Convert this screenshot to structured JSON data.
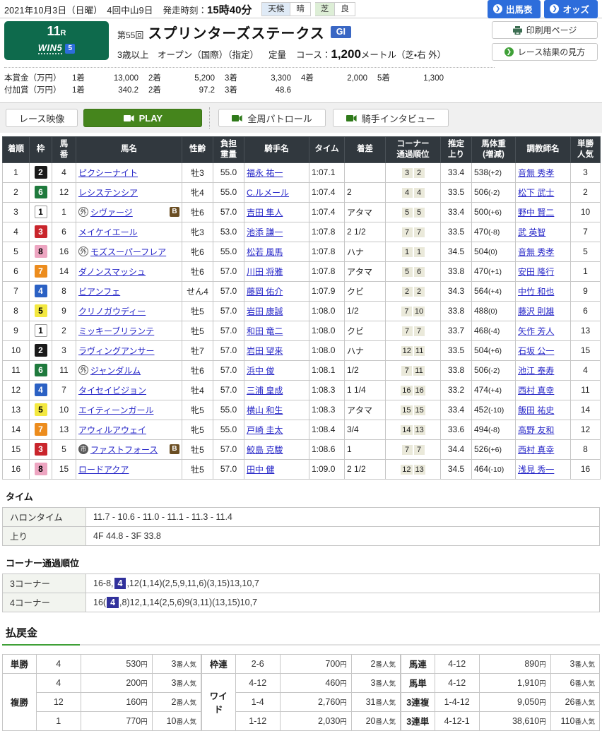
{
  "header": {
    "date": "2021年10月3日（日曜）",
    "meet": "4回中山9日",
    "start_label": "発走時刻：",
    "start_time": "15時40分",
    "weather_label": "天候",
    "weather": "晴",
    "turf_label": "芝",
    "turf_cond": "良",
    "btn_racecard": "出馬表",
    "btn_odds": "オッズ",
    "btn_print": "印刷用ページ",
    "btn_guide": "レース結果の見方"
  },
  "race": {
    "number": "11",
    "r_suffix": "R",
    "win5": "WIN5",
    "win5_badge": "5",
    "edition": "第55回",
    "title": "スプリンターズステークス",
    "grade": "GI",
    "conditions": "3歳以上　オープン（国際）（指定）",
    "weight_rule": "定量",
    "course_label": "コース：",
    "distance": "1,200",
    "course_suffix": "メートル（芝・右 外）"
  },
  "prize": {
    "main_label": "本賞金（万円）",
    "added_label": "付加賞（万円）",
    "places": [
      "1着",
      "2着",
      "3着",
      "4着",
      "5着"
    ],
    "main": [
      "13,000",
      "5,200",
      "3,300",
      "2,000",
      "1,300"
    ],
    "added": [
      "340.2",
      "97.2",
      "48.6"
    ]
  },
  "video": {
    "race_video": "レース映像",
    "play": "PLAY",
    "patrol": "全周パトロール",
    "interview": "騎手インタビュー"
  },
  "results": {
    "columns": [
      "着順",
      "枠",
      "馬\n番",
      "馬名",
      "性齢",
      "負担\n重量",
      "騎手名",
      "タイム",
      "着差",
      "コーナー\n通過順位",
      "推定\n上り",
      "馬体重\n(増減)",
      "調教師名",
      "単勝\n人気"
    ],
    "rows": [
      {
        "pos": "1",
        "frame": "2",
        "num": "4",
        "mark": "",
        "blinker": false,
        "name": "ピクシーナイト",
        "sexage": "牡3",
        "weight": "55.0",
        "jockey": "福永 祐一",
        "time": "1:07.1",
        "margin": "",
        "corners": [
          "3",
          "2"
        ],
        "agari": "33.4",
        "body": "538",
        "diff": "(+2)",
        "trainer": "音無 秀孝",
        "pop": "3"
      },
      {
        "pos": "2",
        "frame": "6",
        "num": "12",
        "mark": "",
        "blinker": false,
        "name": "レシステンシア",
        "sexage": "牝4",
        "weight": "55.0",
        "jockey": "C.ルメール",
        "time": "1:07.4",
        "margin": "2",
        "corners": [
          "4",
          "4"
        ],
        "agari": "33.5",
        "body": "506",
        "diff": "(-2)",
        "trainer": "松下 武士",
        "pop": "2"
      },
      {
        "pos": "3",
        "frame": "1",
        "num": "1",
        "mark": "外",
        "blinker": true,
        "name": "シヴァージ",
        "sexage": "牡6",
        "weight": "57.0",
        "jockey": "吉田 隼人",
        "time": "1:07.4",
        "margin": "アタマ",
        "corners": [
          "5",
          "5"
        ],
        "agari": "33.4",
        "body": "500",
        "diff": "(+6)",
        "trainer": "野中 賢二",
        "pop": "10"
      },
      {
        "pos": "4",
        "frame": "3",
        "num": "6",
        "mark": "",
        "blinker": false,
        "name": "メイケイエール",
        "sexage": "牝3",
        "weight": "53.0",
        "jockey": "池添 謙一",
        "time": "1:07.8",
        "margin": "2 1/2",
        "corners": [
          "7",
          "7"
        ],
        "agari": "33.5",
        "body": "470",
        "diff": "(-8)",
        "trainer": "武 英智",
        "pop": "7"
      },
      {
        "pos": "5",
        "frame": "8",
        "num": "16",
        "mark": "外",
        "blinker": false,
        "name": "モズスーパーフレア",
        "sexage": "牝6",
        "weight": "55.0",
        "jockey": "松若 風馬",
        "time": "1:07.8",
        "margin": "ハナ",
        "corners": [
          "1",
          "1"
        ],
        "agari": "34.5",
        "body": "504",
        "diff": "(0)",
        "trainer": "音無 秀孝",
        "pop": "5"
      },
      {
        "pos": "6",
        "frame": "7",
        "num": "14",
        "mark": "",
        "blinker": false,
        "name": "ダノンスマッシュ",
        "sexage": "牡6",
        "weight": "57.0",
        "jockey": "川田 将雅",
        "time": "1:07.8",
        "margin": "アタマ",
        "corners": [
          "5",
          "6"
        ],
        "agari": "33.8",
        "body": "470",
        "diff": "(+1)",
        "trainer": "安田 隆行",
        "pop": "1"
      },
      {
        "pos": "7",
        "frame": "4",
        "num": "8",
        "mark": "",
        "blinker": false,
        "name": "ビアンフェ",
        "sexage": "せん4",
        "weight": "57.0",
        "jockey": "藤岡 佑介",
        "time": "1:07.9",
        "margin": "クビ",
        "corners": [
          "2",
          "2"
        ],
        "agari": "34.3",
        "body": "564",
        "diff": "(+4)",
        "trainer": "中竹 和也",
        "pop": "9"
      },
      {
        "pos": "8",
        "frame": "5",
        "num": "9",
        "mark": "",
        "blinker": false,
        "name": "クリノガウディー",
        "sexage": "牡5",
        "weight": "57.0",
        "jockey": "岩田 康誠",
        "time": "1:08.0",
        "margin": "1/2",
        "corners": [
          "7",
          "10"
        ],
        "agari": "33.8",
        "body": "488",
        "diff": "(0)",
        "trainer": "藤沢 則雄",
        "pop": "6"
      },
      {
        "pos": "9",
        "frame": "1",
        "num": "2",
        "mark": "",
        "blinker": false,
        "name": "ミッキーブリランテ",
        "sexage": "牡5",
        "weight": "57.0",
        "jockey": "和田 竜二",
        "time": "1:08.0",
        "margin": "クビ",
        "corners": [
          "7",
          "7"
        ],
        "agari": "33.7",
        "body": "468",
        "diff": "(-4)",
        "trainer": "矢作 芳人",
        "pop": "13"
      },
      {
        "pos": "10",
        "frame": "2",
        "num": "3",
        "mark": "",
        "blinker": false,
        "name": "ラヴィングアンサー",
        "sexage": "牡7",
        "weight": "57.0",
        "jockey": "岩田 望来",
        "time": "1:08.0",
        "margin": "ハナ",
        "corners": [
          "12",
          "11"
        ],
        "agari": "33.5",
        "body": "504",
        "diff": "(+6)",
        "trainer": "石坂 公一",
        "pop": "15"
      },
      {
        "pos": "11",
        "frame": "6",
        "num": "11",
        "mark": "外",
        "blinker": false,
        "name": "ジャンダルム",
        "sexage": "牡6",
        "weight": "57.0",
        "jockey": "浜中 俊",
        "time": "1:08.1",
        "margin": "1/2",
        "corners": [
          "7",
          "11"
        ],
        "agari": "33.8",
        "body": "506",
        "diff": "(-2)",
        "trainer": "池江 泰寿",
        "pop": "4"
      },
      {
        "pos": "12",
        "frame": "4",
        "num": "7",
        "mark": "",
        "blinker": false,
        "name": "タイセイビジョン",
        "sexage": "牡4",
        "weight": "57.0",
        "jockey": "三浦 皇成",
        "time": "1:08.3",
        "margin": "1 1/4",
        "corners": [
          "16",
          "16"
        ],
        "agari": "33.2",
        "body": "474",
        "diff": "(+4)",
        "trainer": "西村 真幸",
        "pop": "11"
      },
      {
        "pos": "13",
        "frame": "5",
        "num": "10",
        "mark": "",
        "blinker": false,
        "name": "エイティーンガール",
        "sexage": "牝5",
        "weight": "55.0",
        "jockey": "横山 和生",
        "time": "1:08.3",
        "margin": "アタマ",
        "corners": [
          "15",
          "15"
        ],
        "agari": "33.4",
        "body": "452",
        "diff": "(-10)",
        "trainer": "飯田 祐史",
        "pop": "14"
      },
      {
        "pos": "14",
        "frame": "7",
        "num": "13",
        "mark": "",
        "blinker": false,
        "name": "アウィルアウェイ",
        "sexage": "牝5",
        "weight": "55.0",
        "jockey": "戸崎 圭太",
        "time": "1:08.4",
        "margin": "3/4",
        "corners": [
          "14",
          "13"
        ],
        "agari": "33.6",
        "body": "494",
        "diff": "(-8)",
        "trainer": "高野 友和",
        "pop": "12"
      },
      {
        "pos": "15",
        "frame": "3",
        "num": "5",
        "mark": "市",
        "blinker": true,
        "name": "ファストフォース",
        "sexage": "牡5",
        "weight": "57.0",
        "jockey": "鮫島 克駿",
        "time": "1:08.6",
        "margin": "1",
        "corners": [
          "7",
          "7"
        ],
        "agari": "34.4",
        "body": "526",
        "diff": "(+6)",
        "trainer": "西村 真幸",
        "pop": "8"
      },
      {
        "pos": "16",
        "frame": "8",
        "num": "15",
        "mark": "",
        "blinker": false,
        "name": "ロードアクア",
        "sexage": "牡5",
        "weight": "57.0",
        "jockey": "田中 健",
        "time": "1:09.0",
        "margin": "2 1/2",
        "corners": [
          "12",
          "13"
        ],
        "agari": "34.5",
        "body": "464",
        "diff": "(-10)",
        "trainer": "浅見 秀一",
        "pop": "16"
      }
    ]
  },
  "time_section": {
    "title": "タイム",
    "rows": [
      {
        "label": "ハロンタイム",
        "value": "11.7 - 10.6 - 11.0 - 11.1 - 11.3 - 11.4"
      },
      {
        "label": "上り",
        "value": "4F 44.8 - 3F 33.8"
      }
    ]
  },
  "corner_section": {
    "title": "コーナー通過順位",
    "rows": [
      {
        "label": "3コーナー",
        "pre": "16-8,",
        "hl": "4",
        "post": ",12(1,14)(2,5,9,11,6)(3,15)13,10,7"
      },
      {
        "label": "4コーナー",
        "pre": "16(",
        "hl": "4",
        "post": ",8)12,1,14(2,5,6)9(3,11)(13,15)10,7"
      }
    ]
  },
  "payout": {
    "title": "払戻金",
    "unit_yen": "円",
    "unit_pop": "番人気",
    "groups": [
      {
        "rows": [
          {
            "label": "単勝",
            "span": 1,
            "combo": "4",
            "amount": "530",
            "pop": "3"
          },
          {
            "label": "複勝",
            "span": 3,
            "combo": "4",
            "amount": "200",
            "pop": "3"
          },
          {
            "cont": true,
            "combo": "12",
            "amount": "160",
            "pop": "2"
          },
          {
            "cont": true,
            "combo": "1",
            "amount": "770",
            "pop": "10"
          }
        ]
      },
      {
        "rows": [
          {
            "label": "枠連",
            "span": 1,
            "combo": "2-6",
            "amount": "700",
            "pop": "2"
          },
          {
            "label": "ワイド",
            "span": 3,
            "combo": "4-12",
            "amount": "460",
            "pop": "3"
          },
          {
            "cont": true,
            "combo": "1-4",
            "amount": "2,760",
            "pop": "31"
          },
          {
            "cont": true,
            "combo": "1-12",
            "amount": "2,030",
            "pop": "20"
          }
        ]
      },
      {
        "rows": [
          {
            "label": "馬連",
            "span": 1,
            "combo": "4-12",
            "amount": "890",
            "pop": "3"
          },
          {
            "label": "馬単",
            "span": 1,
            "combo": "4-12",
            "amount": "1,910",
            "pop": "6"
          },
          {
            "label": "3連複",
            "span": 1,
            "combo": "1-4-12",
            "amount": "9,050",
            "pop": "26"
          },
          {
            "label": "3連単",
            "span": 1,
            "combo": "4-12-1",
            "amount": "38,610",
            "pop": "110"
          }
        ]
      }
    ]
  },
  "colors": {
    "brand_green": "#0e6a4c",
    "accent_blue": "#2d6ddb",
    "grade_blue": "#3a67c4",
    "play_green": "#45851c",
    "header_dark": "#31383e",
    "payout_label_bg": "#f0e9d5",
    "highlight_navy": "#31319c"
  }
}
